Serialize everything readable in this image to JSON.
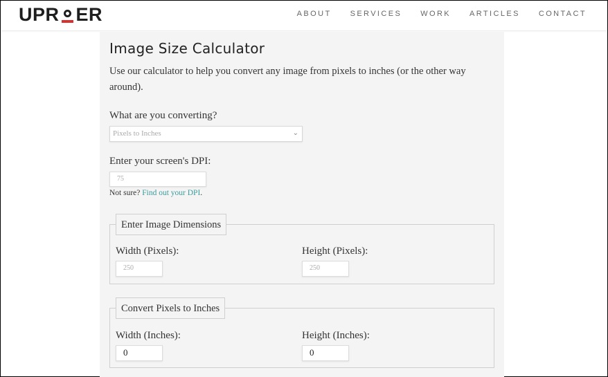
{
  "header": {
    "logo": {
      "prefix": "UPR",
      "suffix": "ER",
      "accent_color": "#d7322f"
    },
    "nav": [
      "ABOUT",
      "SERVICES",
      "WORK",
      "ARTICLES",
      "CONTACT"
    ]
  },
  "main": {
    "title": "Image Size Calculator",
    "intro": "Use our calculator to help you convert any image from pixels to inches (or the other way around).",
    "converting": {
      "label": "What are you converting?",
      "selected": "Pixels to Inches"
    },
    "dpi": {
      "label": "Enter your screen's DPI:",
      "placeholder": "75",
      "note_prefix": "Not sure?",
      "note_link": "Find out your DPI",
      "note_suffix": ".",
      "link_color": "#3c9a9a"
    },
    "dimensions": {
      "legend": "Enter Image Dimensions",
      "width_label": "Width (Pixels):",
      "width_placeholder": "250",
      "height_label": "Height (Pixels):",
      "height_placeholder": "250"
    },
    "result": {
      "legend": "Convert Pixels to Inches",
      "width_label": "Width (Inches):",
      "width_value": "0",
      "height_label": "Height (Inches):",
      "height_value": "0"
    }
  }
}
